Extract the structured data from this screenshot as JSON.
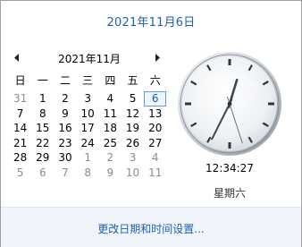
{
  "header": {
    "date_long": "2021年11月6日"
  },
  "calendar": {
    "month_title": "2021年11月",
    "weekdays": [
      "日",
      "一",
      "二",
      "三",
      "四",
      "五",
      "六"
    ],
    "days": [
      {
        "label": "31",
        "other": true
      },
      {
        "label": "1"
      },
      {
        "label": "2"
      },
      {
        "label": "3"
      },
      {
        "label": "4"
      },
      {
        "label": "5"
      },
      {
        "label": "6",
        "today": true
      },
      {
        "label": "7"
      },
      {
        "label": "8"
      },
      {
        "label": "9"
      },
      {
        "label": "10"
      },
      {
        "label": "11"
      },
      {
        "label": "12"
      },
      {
        "label": "13"
      },
      {
        "label": "14"
      },
      {
        "label": "15"
      },
      {
        "label": "16"
      },
      {
        "label": "17"
      },
      {
        "label": "18"
      },
      {
        "label": "19"
      },
      {
        "label": "20"
      },
      {
        "label": "21"
      },
      {
        "label": "22"
      },
      {
        "label": "23"
      },
      {
        "label": "24"
      },
      {
        "label": "25"
      },
      {
        "label": "26"
      },
      {
        "label": "27"
      },
      {
        "label": "28"
      },
      {
        "label": "29"
      },
      {
        "label": "30"
      },
      {
        "label": "1",
        "other": true
      },
      {
        "label": "2",
        "other": true
      },
      {
        "label": "3",
        "other": true
      },
      {
        "label": "4",
        "other": true
      },
      {
        "label": "5",
        "other": true
      },
      {
        "label": "6",
        "other": true
      },
      {
        "label": "7",
        "other": true
      },
      {
        "label": "8",
        "other": true
      },
      {
        "label": "9",
        "other": true
      },
      {
        "label": "10",
        "other": true
      },
      {
        "label": "11",
        "other": true
      }
    ]
  },
  "clock": {
    "time": "12:34:27",
    "hour": 12,
    "minute": 34,
    "second": 27,
    "weekday": "星期六"
  },
  "footer": {
    "link_label": "更改日期和时间设置..."
  },
  "colors": {
    "accent": "#1e5fb3",
    "today_border": "#6b9bd2",
    "footer_bg": "#f1f5fb"
  }
}
